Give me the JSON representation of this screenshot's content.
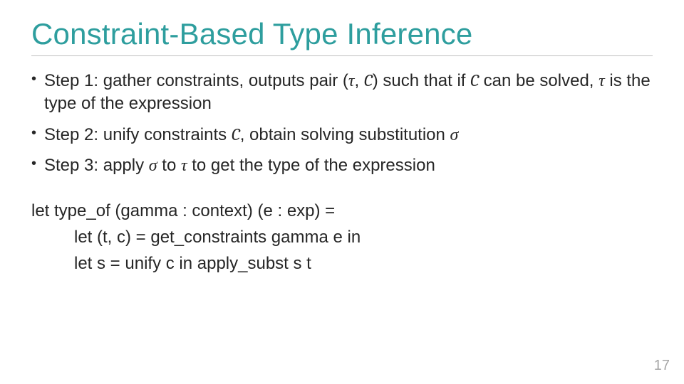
{
  "title": "Constraint-Based Type Inference",
  "bullets": {
    "b1": {
      "pre": "Step 1: gather constraints, outputs pair (",
      "tau1": "τ",
      "mid1": ", ",
      "C1": "C",
      "mid2": ") such that if ",
      "C2": "C",
      "mid3": " can be solved, ",
      "tau2": "τ",
      "post": " is the type of the expression"
    },
    "b2": {
      "pre": "Step 2: unify constraints ",
      "C": "C",
      "mid": ", obtain solving substitution ",
      "sigma": "σ"
    },
    "b3": {
      "pre": "Step 3: apply ",
      "sigma": "σ",
      "mid": " to ",
      "tau": "τ",
      "post": " to get the type of the expression"
    }
  },
  "code": {
    "l1": "let type_of (gamma : context) (e : exp) =",
    "l2": "let (t, c) = get_constraints gamma e in",
    "l3": "let s = unify c in apply_subst s t"
  },
  "pagenum": "17"
}
